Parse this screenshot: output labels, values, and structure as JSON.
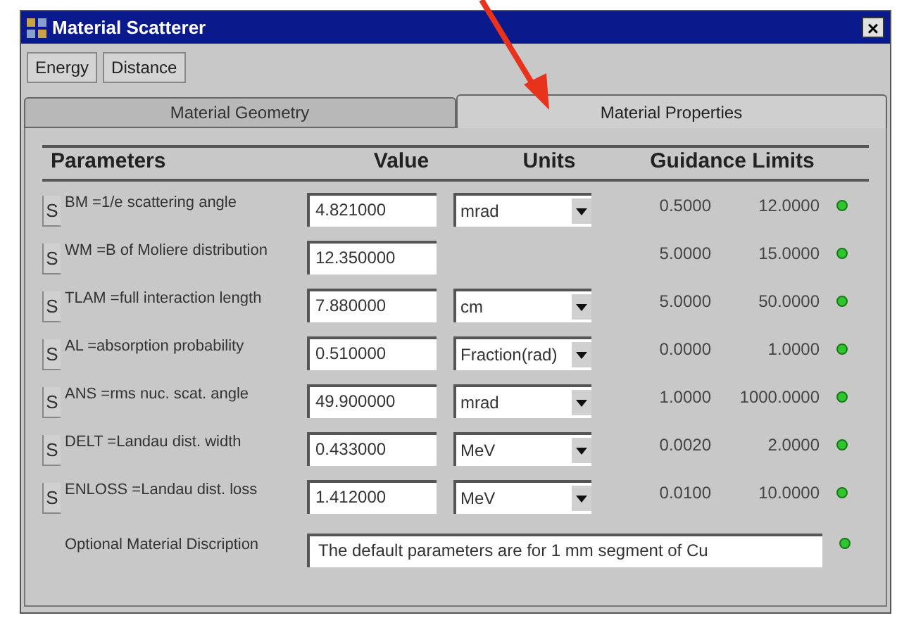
{
  "window": {
    "title": "Material Scatterer",
    "close": "×"
  },
  "toolbar": [
    "Energy",
    "Distance"
  ],
  "tabs": [
    {
      "label": "Material Geometry",
      "selected": false
    },
    {
      "label": "Material Properties",
      "selected": true
    }
  ],
  "columns": [
    "Parameters",
    "Value",
    "Units",
    "Guidance Limits"
  ],
  "rows": [
    {
      "button": "S",
      "label": "BM =1/e scattering angle",
      "value": "4.821000",
      "units": "mrad",
      "min": "0.5000",
      "max": "12.0000",
      "valid": true
    },
    {
      "button": "S",
      "label": "WM =B of Moliere distribution",
      "value": "12.350000",
      "min": "5.0000",
      "max": "15.0000",
      "valid": true
    },
    {
      "button": "S",
      "label": "TLAM =full interaction length",
      "value": "7.880000",
      "units": "cm",
      "min": "5.0000",
      "max": "50.0000",
      "valid": true
    },
    {
      "button": "S",
      "label": "AL =absorption probability",
      "value": "0.510000",
      "units": "Fraction(rad)",
      "min": "0.0000",
      "max": "1.0000",
      "valid": true
    },
    {
      "button": "S",
      "label": "ANS =rms nuc. scat. angle",
      "value": "49.900000",
      "units": "mrad",
      "min": "1.0000",
      "max": "1000.0000",
      "valid": true
    },
    {
      "button": "S",
      "label": "DELT =Landau dist. width",
      "value": "0.433000",
      "units": "MeV",
      "min": "0.0020",
      "max": "2.0000",
      "valid": true
    },
    {
      "button": "S",
      "label": "ENLOSS =Landau dist. loss",
      "value": "1.412000",
      "units": "MeV",
      "min": "0.0100",
      "max": "10.0000",
      "valid": true
    }
  ],
  "description": {
    "label": "Optional Material Discription",
    "value": "The default parameters are for 1 mm segment of Cu",
    "valid": true
  }
}
